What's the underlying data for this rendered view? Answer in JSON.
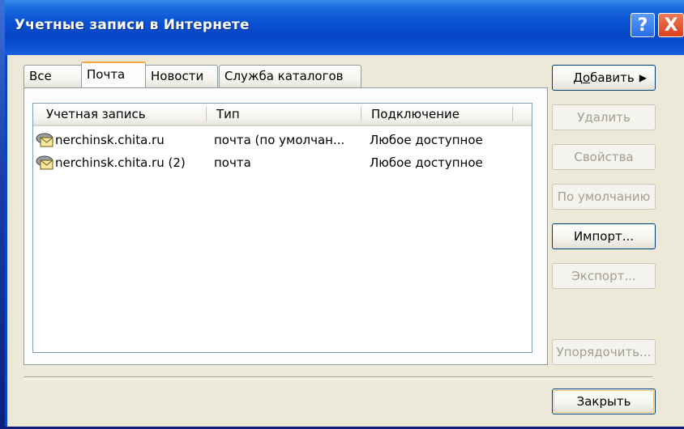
{
  "window": {
    "title": "Учетные записи в Интернете"
  },
  "titlebar_buttons": {
    "help": "?",
    "close": "X"
  },
  "tabs": [
    {
      "label": "Все",
      "active": false
    },
    {
      "label": "Почта",
      "active": true
    },
    {
      "label": "Новости",
      "active": false
    },
    {
      "label": "Служба каталогов",
      "active": false
    }
  ],
  "list": {
    "columns": [
      "Учетная запись",
      "Тип",
      "Подключение"
    ],
    "rows": [
      {
        "account": "nerchinsk.chita.ru",
        "type": "почта (по умолчан...",
        "connection": "Любое доступное",
        "icon": "mail-account-icon"
      },
      {
        "account": "nerchinsk.chita.ru (2)",
        "type": "почта",
        "connection": "Любое доступное",
        "icon": "mail-account-icon"
      }
    ]
  },
  "buttons": {
    "add_pre": "Д",
    "add_u": "о",
    "add_post": "бавить",
    "add_arrow": "▶",
    "remove": "Удалить",
    "properties": "Свойства",
    "default": "По умолчанию",
    "import": "Импорт...",
    "export": "Экспорт...",
    "order": "Упорядочить...",
    "close": "Закрыть"
  }
}
